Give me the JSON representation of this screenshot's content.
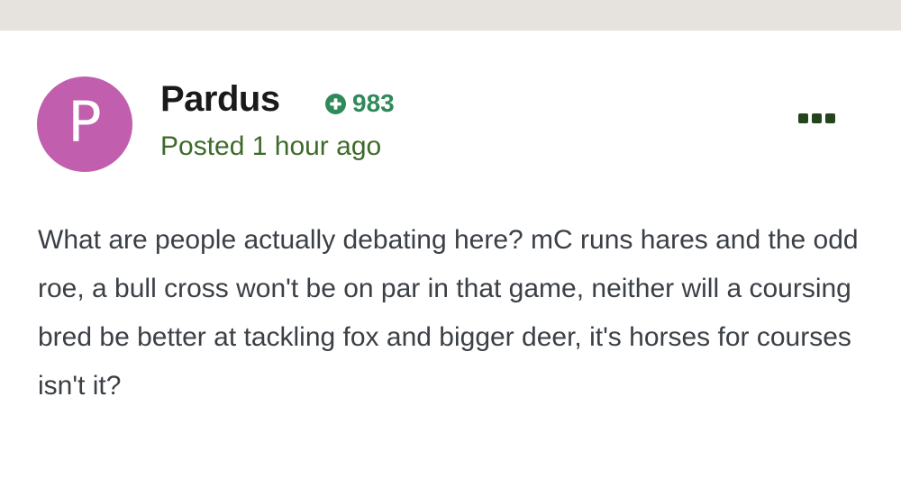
{
  "author": {
    "avatar_letter": "P",
    "avatar_color": "#c15eae",
    "name": "Pardus",
    "reputation": "983",
    "reputation_icon": "plus-circle-icon",
    "posted_time": "Posted 1 hour ago"
  },
  "actions": {
    "more_icon": "ellipsis-icon"
  },
  "post": {
    "body": "What are people actually debating here? mC runs hares and the odd roe, a bull cross won't be on par in that game, neither will a coursing bred be better at tackling fox and bigger deer, it's horses for courses isn't it?"
  },
  "colors": {
    "reputation": "#2f8a5a",
    "posted": "#3e6a29",
    "more_button": "#24451c",
    "top_strip": "#e6e3df"
  }
}
